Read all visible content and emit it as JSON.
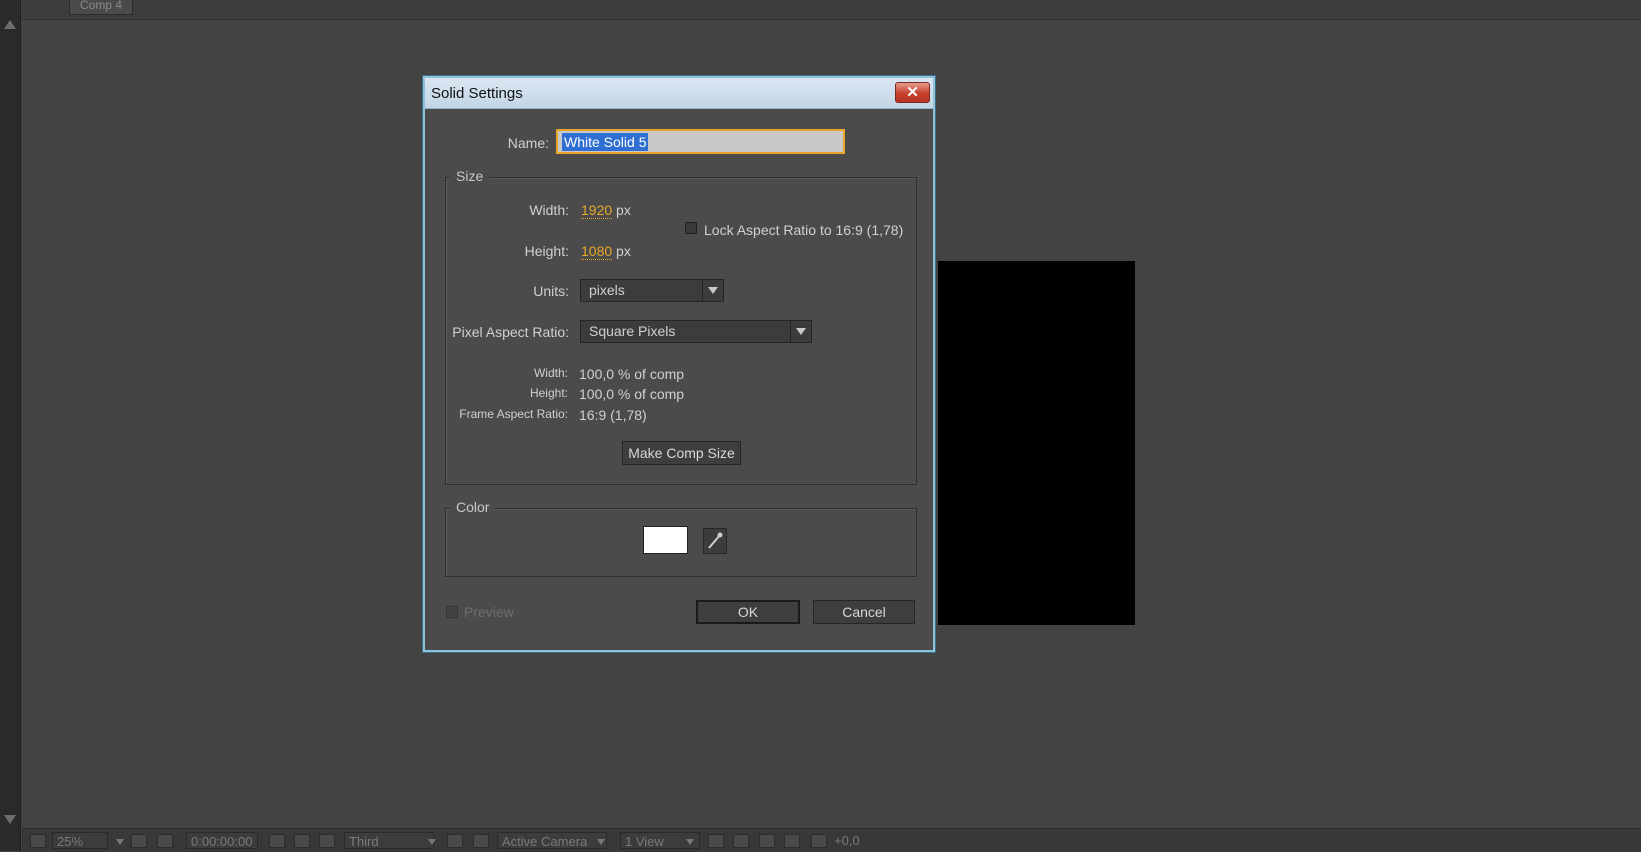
{
  "comp_tab": "Comp 4",
  "dialog": {
    "title": "Solid Settings",
    "close_symbol": "✕",
    "name_label": "Name:",
    "name_value": "White Solid 5",
    "size": {
      "legend": "Size",
      "width_label": "Width:",
      "width_value": "1920",
      "width_unit": "px",
      "height_label": "Height:",
      "height_value": "1080",
      "height_unit": "px",
      "lock_label": "Lock Aspect Ratio to 16:9 (1,78)",
      "units_label": "Units:",
      "units_value": "pixels",
      "par_label": "Pixel Aspect Ratio:",
      "par_value": "Square Pixels",
      "info_width_label": "Width:",
      "info_width_value": "100,0 % of comp",
      "info_height_label": "Height:",
      "info_height_value": "100,0 % of comp",
      "info_far_label": "Frame Aspect Ratio:",
      "info_far_value": "16:9 (1,78)",
      "make_comp_size": "Make Comp Size"
    },
    "color": {
      "legend": "Color",
      "swatch_color": "#ffffff"
    },
    "preview_label": "Preview",
    "ok_label": "OK",
    "cancel_label": "Cancel"
  },
  "bottombar": {
    "zoom": "25%",
    "timecode": "0:00:00:00",
    "resolution": "Third",
    "camera": "Active Camera",
    "views": "1 View",
    "exposure": "+0,0"
  }
}
